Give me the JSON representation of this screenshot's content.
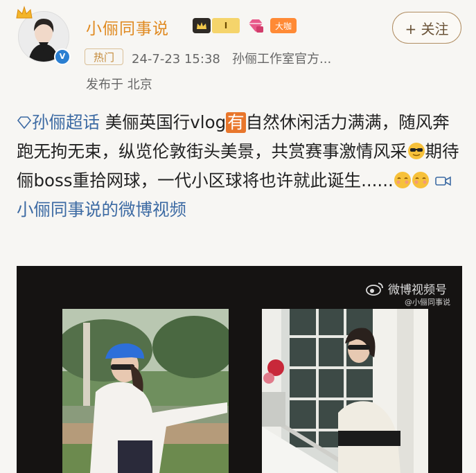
{
  "user": {
    "name": "小俪同事说",
    "level": "I",
    "badge_text": "大咖",
    "verified_icon": "v-verified-icon",
    "follow_label": "+ 关注"
  },
  "post_meta": {
    "hot_label": "热门",
    "timestamp": "24-7-23 15:38",
    "source": "孙俪工作室官方...",
    "location": "发布于 北京"
  },
  "post": {
    "topic": "孙俪超话",
    "text_a": " 美俪英国行vlog",
    "yo_label": "有",
    "text_b": "自然休闲活力满满，随风奔跑无拘无束，纵览伦敦街头美景，共赏赛事激情风采",
    "text_c": "期待俪boss重拾网球，一代小区球将也许就此诞生......",
    "video_link": "小俪同事说的微博视频"
  },
  "video": {
    "watermark": "微博视频号",
    "watermark_sub": "@小俪同事说"
  },
  "colors": {
    "name": "#e08a21",
    "link": "#3c6aa3",
    "background": "#f7f6f3",
    "video_bg": "#151312"
  }
}
